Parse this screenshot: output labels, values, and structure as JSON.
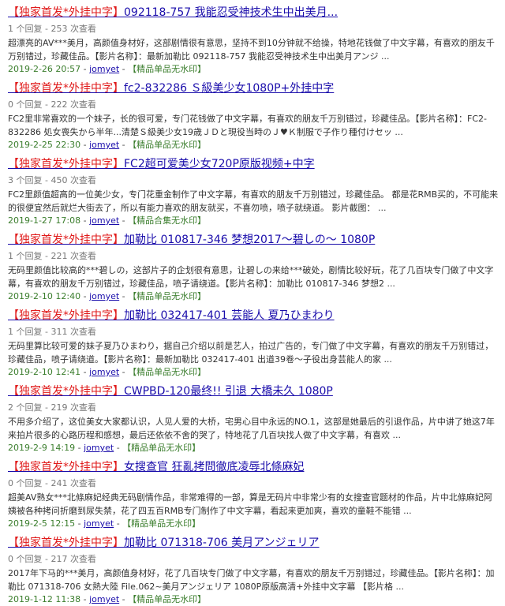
{
  "posts": [
    {
      "tag_open": "【",
      "tag_word": "独家首发",
      "tag_sep": "*",
      "tag_word2": "外挂中字",
      "tag_close": "】",
      "headline": "092118-757 我能忍受神技术生中出美月...",
      "meta": "1 个回复 - 253 次查看",
      "excerpt": "超漂亮的AV***美月，高颜值身材好，这部剧情很有意思，坚持不到10分钟就不给操，特地花钱做了中文字幕，有喜欢的朋友千万别错过，珍藏佳品。【影片名称】：最新加勒比 092118-757 我能忍受神技术生中出美月アンジ ...",
      "date": "2019-2-26 20:57",
      "author": "jomyet",
      "category": "【精品单品无水印】"
    },
    {
      "tag_open": "【",
      "tag_word": "独家首发",
      "tag_sep": "*",
      "tag_word2": "外挂中字",
      "tag_close": "】",
      "headline": "fc2-832286 Ｓ級美少女1080P+外挂中字",
      "meta": "0 个回复 - 222 次查看",
      "excerpt": "FC2里非常喜欢的一个妹子，长的很可爱，专门花钱做了中文字幕，有喜欢的朋友千万别错过，珍藏佳品。【影片名称】：FC2-832286 処女喪失から半年...清楚Ｓ級美少女19歳ＪＤと現役当時のＪ♥Ｋ制服で子作り種付けセッ ...",
      "date": "2019-2-25 22:30",
      "author": "jomyet",
      "category": "【精品单品无水印】"
    },
    {
      "tag_open": "【",
      "tag_word": "独家首发",
      "tag_sep": "*",
      "tag_word2": "外挂中字",
      "tag_close": "】",
      "headline": "FC2超可爱美少女720P原版视频+中字",
      "meta": "3 个回复 - 450 次查看",
      "excerpt": "FC2里颜值超高的一位美少女，专门花重金制作了中文字幕，有喜欢的朋友千万别错过，珍藏佳品。 都是花RMB买的，不可能来的很便宜然后就烂大街去了，所以有能力喜欢的朋友就买，不喜勿喷，喷子就绕道。 影片截图： ...",
      "date": "2019-1-27 17:08",
      "author": "jomyet",
      "category": "【精品合集无水印】"
    },
    {
      "tag_open": "【",
      "tag_word": "独家首发",
      "tag_sep": "*",
      "tag_word2": "外挂中字",
      "tag_close": "】",
      "headline": "加勒比 010817-346 梦想2017～碧しの～ 1080P",
      "meta": "1 个回复 - 221 次查看",
      "excerpt": "无码里颜值比较高的***碧しの，这部片子的企划很有意思，让碧しの来给***破处，剧情比较好玩，花了几百块专门做了中文字幕，有喜欢的朋友千万别错过，珍藏佳品，喷子请绕道。【影片名称】：加勒比 010817-346 梦想2 ...",
      "date": "2019-2-10 12:40",
      "author": "jomyet",
      "category": "【精品单品无水印】"
    },
    {
      "tag_open": "【",
      "tag_word": "独家首发",
      "tag_sep": "*",
      "tag_word2": "外挂中字",
      "tag_close": "】",
      "headline": "加勒比 032417-401 芸能人 夏乃ひまわり",
      "meta": "1 个回复 - 311 次查看",
      "excerpt": "无码里算比较可爱的妹子夏乃ひまわり，据自己介绍以前是艺人，拍过广告的，专门做了中文字幕，有喜欢的朋友千万别错过，珍藏佳品，喷子请绕道。【影片名称】：最新加勒比 032417-401 出道39卷～子役出身芸能人的家 ...",
      "date": "2019-2-10 12:41",
      "author": "jomyet",
      "category": "【精品单品无水印】"
    },
    {
      "tag_open": "【",
      "tag_word": "独家首发",
      "tag_sep": "*",
      "tag_word2": "外挂中字",
      "tag_close": "】",
      "headline": "CWPBD-120最终!! 引退 大橋未久 1080P",
      "meta": "2 个回复 - 219 次查看",
      "excerpt": "不用多介绍了，这位美女大家都认识，人见人爱的大桥，宅男心目中永远的NO.1，这部是她最后的引退作品，片中讲了她这7年来拍片很多的心路历程和感想，最后还依依不舍的哭了，特地花了几百块找人做了中文字幕，有喜欢 ...",
      "date": "2019-2-9 14:19",
      "author": "jomyet",
      "category": "【精品单品无水印】"
    },
    {
      "tag_open": "【",
      "tag_word": "独家首发",
      "tag_sep": "*",
      "tag_word2": "外挂中字",
      "tag_close": "】",
      "headline": "女搜查官 狂亂拷問徹底凌辱北條麻妃",
      "meta": "0 个回复 - 241 次查看",
      "excerpt": "超美AV熟女***北條麻妃经典无码剧情作品，非常难得的一部，算是无码片中非常少有的女搜查官题材的作品，片中北條麻妃阿姨被各种拷问折磨到尿失禁，花了四五百RMB专门制作了中文字幕，看起来更加爽，喜欢的童鞋不能错 ...",
      "date": "2019-2-5 12:15",
      "author": "jomyet",
      "category": "【精品单品无水印】"
    },
    {
      "tag_open": "【",
      "tag_word": "独家首发",
      "tag_sep": "*",
      "tag_word2": "外挂中字",
      "tag_close": "】",
      "headline": "加勒比 071318-706 美月アンジェリア",
      "meta": "0 个回复 - 217 次查看",
      "excerpt": "2017年下马的***美月，高颜值身材好，花了几百块专门做了中文字幕，有喜欢的朋友千万别错过，珍藏佳品。【影片名称】：加勒比 071318-706 女熱大陸 File.062~美月アンジェリア 1080P原版高清+外挂中文字幕 【影片格 ...",
      "date": "2019-1-12 11:38",
      "author": "jomyet",
      "category": "【精品单品无水印】"
    }
  ],
  "separator": " - "
}
